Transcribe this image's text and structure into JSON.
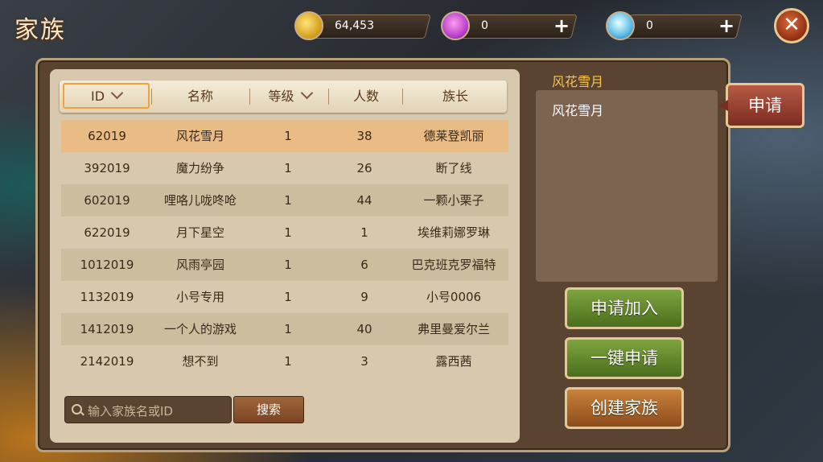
{
  "title": "家族",
  "currencies": [
    {
      "icon": "coin-icon",
      "value": "64,453",
      "has_plus": false
    },
    {
      "icon": "gem-icon",
      "value": "0",
      "has_plus": true
    },
    {
      "icon": "diamond-icon",
      "value": "0",
      "has_plus": true
    }
  ],
  "close_label": "✕",
  "table": {
    "headers": [
      "ID",
      "名称",
      "等级",
      "人数",
      "族长"
    ],
    "rows": [
      [
        "62019",
        "风花雪月",
        "1",
        "38",
        "德莱登凯丽"
      ],
      [
        "392019",
        "魔力纷争",
        "1",
        "26",
        "断了线"
      ],
      [
        "602019",
        "哩咯儿咙咚呛",
        "1",
        "44",
        "一颗小栗子"
      ],
      [
        "622019",
        "月下星空",
        "1",
        "1",
        "埃维莉娜罗琳"
      ],
      [
        "1012019",
        "风雨亭园",
        "1",
        "6",
        "巴克班克罗福特"
      ],
      [
        "1132019",
        "小号专用",
        "1",
        "9",
        "小号0006"
      ],
      [
        "1412019",
        "一个人的游戏",
        "1",
        "40",
        "弗里曼爱尔兰"
      ],
      [
        "2142019",
        "想不到",
        "1",
        "3",
        "露西茜"
      ]
    ]
  },
  "search": {
    "placeholder": "输入家族名或ID",
    "button": "搜索"
  },
  "detail": {
    "name": "风花雪月",
    "description": "风花雪月"
  },
  "apply_tab": "申请",
  "buttons": {
    "join": "申请加入",
    "one_click": "一键申请",
    "create": "创建家族"
  }
}
